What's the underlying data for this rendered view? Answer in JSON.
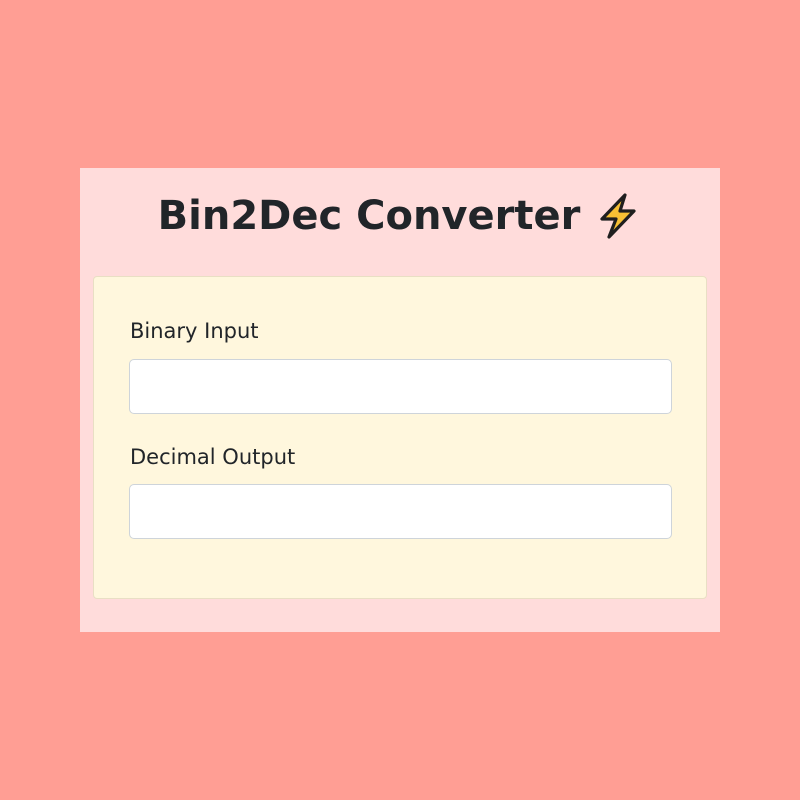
{
  "app": {
    "title": "Bin2Dec Converter",
    "title_icon": "lightning-bolt-icon",
    "colors": {
      "page_background": "#ff9e94",
      "panel_background": "#ffdcdb",
      "card_background": "#fff7dd",
      "bolt_fill": "#f7c034",
      "bolt_outline": "#1f1f1f"
    }
  },
  "form": {
    "binary_label": "Binary Input",
    "binary_value": "",
    "binary_placeholder": "",
    "decimal_label": "Decimal Output",
    "decimal_value": "",
    "decimal_placeholder": ""
  }
}
